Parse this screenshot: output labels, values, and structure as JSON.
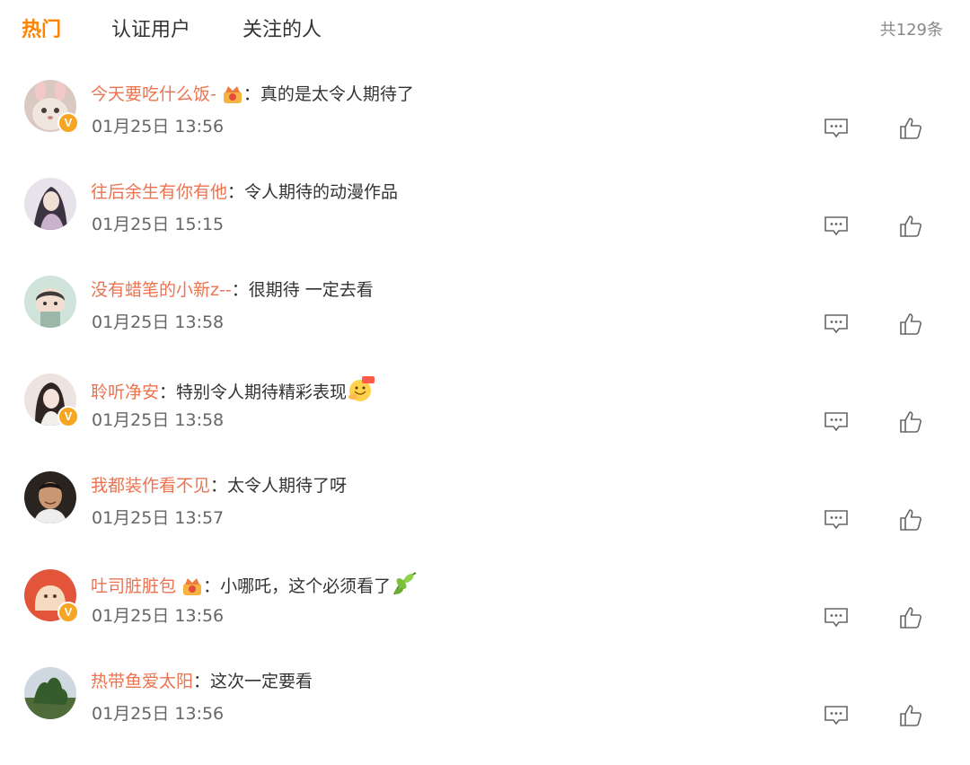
{
  "tabs": [
    {
      "label": "热门",
      "active": true
    },
    {
      "label": "认证用户",
      "active": false
    },
    {
      "label": "关注的人",
      "active": false
    }
  ],
  "total_count": "共129条",
  "colors": {
    "accent": "#ff8200",
    "username": "#eb7350",
    "verified_badge": "#f6a623"
  },
  "comments": [
    {
      "user": "今天要吃什么饭-",
      "sep": "：",
      "text": "真的是太令人期待了",
      "time": "01月25日 13:56",
      "verified": true,
      "medal": "crown-medal-icon",
      "emoji": ""
    },
    {
      "user": "往后余生有你有他",
      "sep": "：",
      "text": "令人期待的动漫作品",
      "time": "01月25日 15:15",
      "verified": false,
      "medal": "",
      "emoji": ""
    },
    {
      "user": "没有蜡笔的小新z--",
      "sep": "：",
      "text": "很期待 一定去看",
      "time": "01月25日 13:58",
      "verified": false,
      "medal": "",
      "emoji": ""
    },
    {
      "user": "聆听净安",
      "sep": "：",
      "text": "特别令人期待精彩表现",
      "time": "01月25日 13:58",
      "verified": true,
      "medal": "",
      "emoji": "666-emoji-icon"
    },
    {
      "user": "我都装作看不见",
      "sep": "：",
      "text": "太令人期待了呀",
      "time": "01月25日 13:57",
      "verified": false,
      "medal": "",
      "emoji": ""
    },
    {
      "user": "吐司脏脏包",
      "sep": "：",
      "text": "小哪吒，这个必须看了",
      "time": "01月25日 13:56",
      "verified": true,
      "medal": "crown-medal-icon",
      "emoji": "leaf-emoji-icon"
    },
    {
      "user": "热带鱼爱太阳",
      "sep": "：",
      "text": "这次一定要看",
      "time": "01月25日 13:56",
      "verified": false,
      "medal": "",
      "emoji": ""
    }
  ],
  "verified_mark": "V"
}
